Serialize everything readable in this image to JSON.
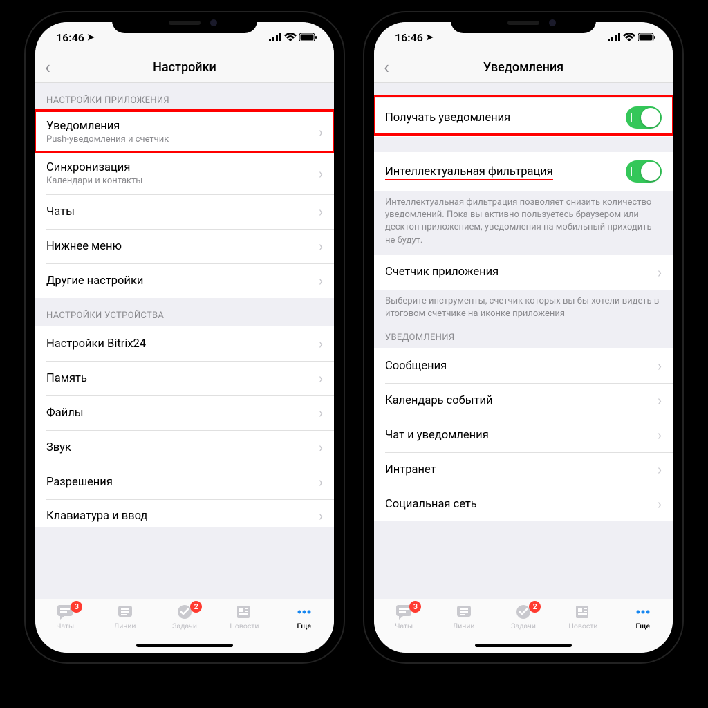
{
  "status": {
    "time": "16:46",
    "location_icon": "location-arrow"
  },
  "left_phone": {
    "nav_title": "Настройки",
    "section1_header": "НАСТРОЙКИ ПРИЛОЖЕНИЯ",
    "rows1": [
      {
        "title": "Уведомления",
        "sub": "Push-уведомления и счетчик"
      },
      {
        "title": "Синхронизация",
        "sub": "Календари и контакты"
      },
      {
        "title": "Чаты"
      },
      {
        "title": "Нижнее меню"
      },
      {
        "title": "Другие настройки"
      }
    ],
    "section2_header": "НАСТРОЙКИ УСТРОЙСТВА",
    "rows2": [
      {
        "title": "Настройки Bitrix24"
      },
      {
        "title": "Память"
      },
      {
        "title": "Файлы"
      },
      {
        "title": "Звук"
      },
      {
        "title": "Разрешения"
      },
      {
        "title": "Клавиатура и ввод"
      }
    ]
  },
  "right_phone": {
    "nav_title": "Уведомления",
    "row_receive": "Получать уведомления",
    "row_filter": "Интеллектуальная фильтрация",
    "filter_footer": "Интеллектуальная фильтрация позволяет снизить количество уведомлений. Пока вы активно пользуетесь браузером или десктоп приложением, уведомления на мобильный приходить не будут.",
    "row_counter": "Счетчик приложения",
    "counter_footer": "Выберите инструменты, счетчик которых вы бы хотели видеть в итоговом счетчике на иконке приложения",
    "section_notif_header": "УВЕДОМЛЕНИЯ",
    "rows": [
      {
        "title": "Сообщения"
      },
      {
        "title": "Календарь событий"
      },
      {
        "title": "Чат и уведомления"
      },
      {
        "title": "Интранет"
      },
      {
        "title": "Социальная сеть"
      }
    ]
  },
  "tabbar": {
    "tabs": [
      {
        "label": "Чаты",
        "badge": "3"
      },
      {
        "label": "Линии"
      },
      {
        "label": "Задачи",
        "badge": "2"
      },
      {
        "label": "Новости"
      },
      {
        "label": "Еще",
        "active": true
      }
    ]
  }
}
